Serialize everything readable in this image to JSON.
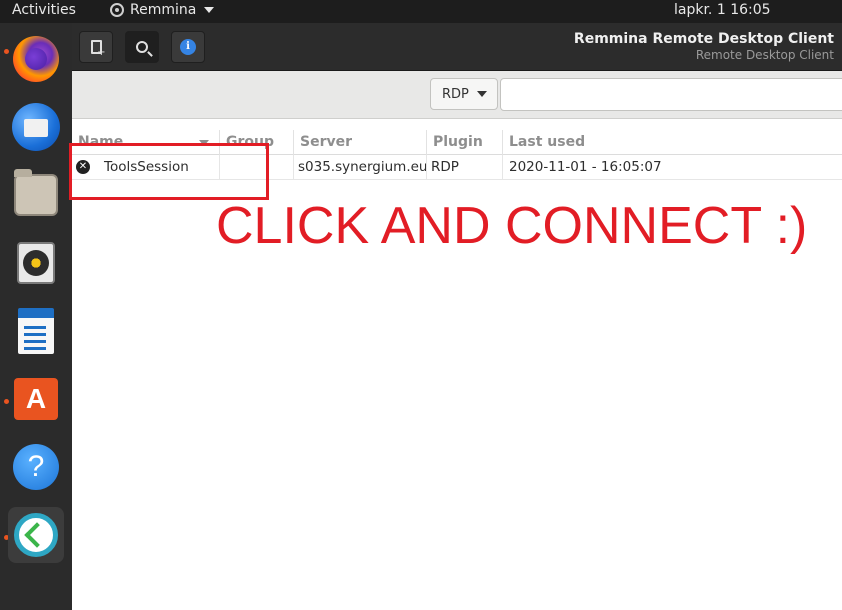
{
  "topbar": {
    "activities": "Activities",
    "app_name": "Remmina",
    "clock": "lapkr. 1  16:05"
  },
  "dock": {
    "items": [
      {
        "name": "firefox",
        "icon": "firefox-icon"
      },
      {
        "name": "thunderbird",
        "icon": "thunderbird-icon"
      },
      {
        "name": "files",
        "icon": "files-icon"
      },
      {
        "name": "rhythmbox",
        "icon": "rhythmbox-icon"
      },
      {
        "name": "libreoffice-writer",
        "icon": "writer-icon"
      },
      {
        "name": "ubuntu-software",
        "icon": "store-icon",
        "glyph": "A"
      },
      {
        "name": "help",
        "icon": "help-icon",
        "glyph": "?"
      },
      {
        "name": "remmina",
        "icon": "remmina-icon"
      }
    ]
  },
  "headerbar": {
    "title": "Remmina Remote Desktop Client",
    "subtitle": "Remote Desktop Client",
    "info_glyph": "i"
  },
  "searchbar": {
    "protocol": "RDP",
    "input_value": ""
  },
  "table": {
    "columns": [
      "Name",
      "Group",
      "Server",
      "Plugin",
      "Last used"
    ],
    "rows": [
      {
        "name": "ToolsSession",
        "group": "",
        "server": "s035.synergium.eu",
        "plugin": "RDP",
        "last_used": "2020-11-01 - 16:05:07"
      }
    ]
  },
  "annotation": {
    "text": "CLICK AND CONNECT :)",
    "color": "#e21d25"
  },
  "colors": {
    "accent": "#e95420",
    "headerbar_bg": "#2c2c2c",
    "dock_bg": "#2b2b2b"
  }
}
